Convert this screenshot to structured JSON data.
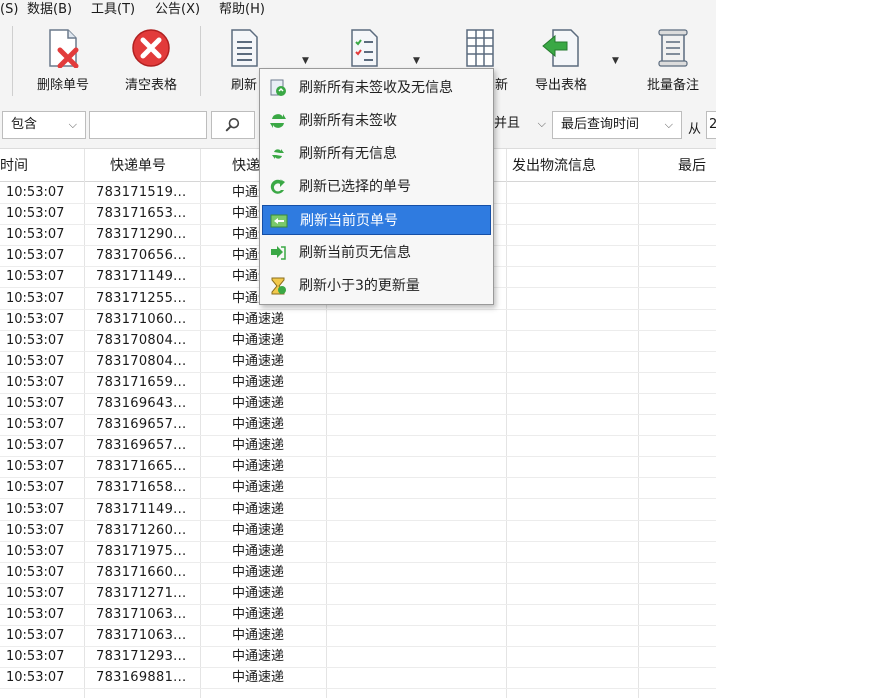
{
  "menubar": {
    "items": [
      {
        "label": "(S)"
      },
      {
        "label": "数据(B)"
      },
      {
        "label": "工具(T)"
      },
      {
        "label": "公告(X)"
      },
      {
        "label": "帮助(H)"
      }
    ]
  },
  "toolbar": {
    "delete_label": "删除单号",
    "clear_label": "清空表格",
    "refresh_label": "刷新",
    "import_label": "新",
    "export_label": "导出表格",
    "remark_label": "批量备注"
  },
  "filter": {
    "contains": "包含",
    "keyword_value": "",
    "and_label": "并且",
    "date_field": "最后查询时间",
    "from_label": "从",
    "date_partial": "2"
  },
  "table": {
    "columns": [
      "时间",
      "快递单号",
      "快递",
      "发出物流信息",
      "最后"
    ],
    "rows": [
      {
        "time": "10:53:07",
        "number": "783171519...",
        "courier": "中通速递"
      },
      {
        "time": "10:53:07",
        "number": "783171653...",
        "courier": "中通速递"
      },
      {
        "time": "10:53:07",
        "number": "783171290...",
        "courier": "中通速递"
      },
      {
        "time": "10:53:07",
        "number": "783170656...",
        "courier": "中通速递"
      },
      {
        "time": "10:53:07",
        "number": "783171149...",
        "courier": "中通速递"
      },
      {
        "time": "10:53:07",
        "number": "783171255...",
        "courier": "中通速递"
      },
      {
        "time": "10:53:07",
        "number": "783171060...",
        "courier": "中通速递"
      },
      {
        "time": "10:53:07",
        "number": "783170804...",
        "courier": "中通速递"
      },
      {
        "time": "10:53:07",
        "number": "783170804...",
        "courier": "中通速递"
      },
      {
        "time": "10:53:07",
        "number": "783171659...",
        "courier": "中通速递"
      },
      {
        "time": "10:53:07",
        "number": "783169643...",
        "courier": "中通速递"
      },
      {
        "time": "10:53:07",
        "number": "783169657...",
        "courier": "中通速递"
      },
      {
        "time": "10:53:07",
        "number": "783169657...",
        "courier": "中通速递"
      },
      {
        "time": "10:53:07",
        "number": "783171665...",
        "courier": "中通速递"
      },
      {
        "time": "10:53:07",
        "number": "783171658...",
        "courier": "中通速递"
      },
      {
        "time": "10:53:07",
        "number": "783171149...",
        "courier": "中通速递"
      },
      {
        "time": "10:53:07",
        "number": "783171260...",
        "courier": "中通速递"
      },
      {
        "time": "10:53:07",
        "number": "783171975...",
        "courier": "中通速递"
      },
      {
        "time": "10:53:07",
        "number": "783171660...",
        "courier": "中通速递"
      },
      {
        "time": "10:53:07",
        "number": "783171271...",
        "courier": "中通速递"
      },
      {
        "time": "10:53:07",
        "number": "783171063...",
        "courier": "中通速递"
      },
      {
        "time": "10:53:07",
        "number": "783171063...",
        "courier": "中通速递"
      },
      {
        "time": "10:53:07",
        "number": "783171293...",
        "courier": "中通速递"
      },
      {
        "time": "10:53:07",
        "number": "783169881...",
        "courier": "中通速递"
      }
    ]
  },
  "context_menu": {
    "items": [
      {
        "label": "刷新所有未签收及无信息",
        "icon": "refresh-all-icon"
      },
      {
        "label": "刷新所有未签收",
        "icon": "refresh-arrows-icon"
      },
      {
        "label": "刷新所有无信息",
        "icon": "refresh-small-icon"
      },
      {
        "label": "刷新已选择的单号",
        "icon": "refresh-selected-icon"
      },
      {
        "label": "刷新当前页单号",
        "icon": "refresh-page-icon",
        "selected": true
      },
      {
        "label": "刷新当前页无信息",
        "icon": "refresh-page-empty-icon"
      },
      {
        "label": "刷新小于3的更新量",
        "icon": "hourglass-icon"
      }
    ]
  },
  "colors": {
    "selection": "#2f7be0",
    "refresh_green": "#3aa845",
    "delete_red": "#e23b3b"
  }
}
